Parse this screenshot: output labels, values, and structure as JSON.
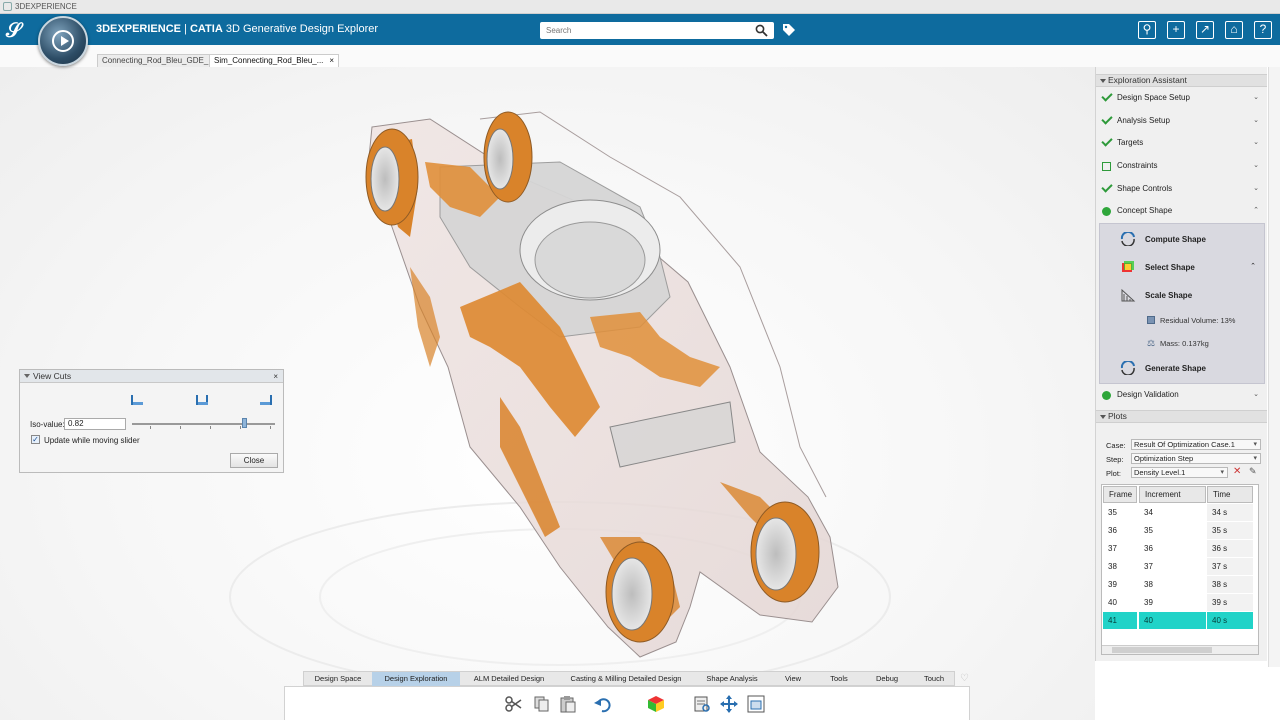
{
  "window": {
    "title": "3DEXPERIENCE"
  },
  "header": {
    "brand": "3DEXPERIENCE",
    "separator": " | ",
    "app_brand": "CATIA",
    "app_name": " 3D Generative Design Explorer",
    "search_placeholder": "Search",
    "right_icons": [
      "user-icon",
      "plus-icon",
      "share-icon",
      "home-icon",
      "help-icon"
    ]
  },
  "doc_tabs": [
    {
      "label": "Connecting_Rod_Bleu_GDE_...",
      "active": false
    },
    {
      "label": "Sim_Connecting_Rod_Bleu_...",
      "active": true,
      "close": "×"
    }
  ],
  "view_cuts": {
    "title": "View Cuts",
    "close_x": "×",
    "iso_label": "Iso-value:",
    "iso_value": "0.82",
    "iso_slider_fraction": 0.82,
    "update_label": "Update while moving slider",
    "update_checked": true,
    "close_button": "Close"
  },
  "exploration_assistant": {
    "title": "Exploration Assistant",
    "steps": [
      {
        "label": "Design Space Setup",
        "status": "done"
      },
      {
        "label": "Analysis Setup",
        "status": "done"
      },
      {
        "label": "Targets",
        "status": "done"
      },
      {
        "label": "Constraints",
        "status": "empty"
      },
      {
        "label": "Shape Controls",
        "status": "done"
      },
      {
        "label": "Concept Shape",
        "status": "active",
        "expanded": true
      }
    ],
    "concept_shape": {
      "compute": "Compute Shape",
      "select": "Select Shape",
      "scale": "Scale Shape",
      "residual_volume": "Residual Volume: 13%",
      "mass": "Mass: 0.137kg",
      "generate": "Generate Shape"
    },
    "design_validation": "Design Validation"
  },
  "plots": {
    "title": "Plots",
    "case_label": "Case:",
    "case_value": "Result Of Optimization Case.1",
    "step_label": "Step:",
    "step_value": "Optimization Step",
    "plot_label": "Plot:",
    "plot_value": "Density Level.1",
    "columns": [
      "Frame",
      "Increment",
      "Time"
    ],
    "rows": [
      [
        "35",
        "34",
        "34 s"
      ],
      [
        "36",
        "35",
        "35 s"
      ],
      [
        "37",
        "36",
        "36 s"
      ],
      [
        "38",
        "37",
        "37 s"
      ],
      [
        "39",
        "38",
        "38 s"
      ],
      [
        "40",
        "39",
        "39 s"
      ],
      [
        "41",
        "40",
        "40 s"
      ]
    ],
    "selected_row": 6
  },
  "bottom_tabs": [
    {
      "label": "Design Space",
      "active": false
    },
    {
      "label": "Design Exploration",
      "active": true
    },
    {
      "label": "ALM Detailed Design",
      "active": false
    },
    {
      "label": "Casting & Milling Detailed Design",
      "active": false
    },
    {
      "label": "Shape Analysis",
      "active": false
    },
    {
      "label": "View",
      "active": false
    },
    {
      "label": "Tools",
      "active": false
    },
    {
      "label": "Debug",
      "active": false
    },
    {
      "label": "Touch",
      "active": false
    }
  ],
  "action_icons": [
    "cut-icon",
    "copy-icon",
    "paste-icon",
    "undo-icon",
    "color-cube-icon",
    "view-cut-icon",
    "move-icon",
    "frame-icon"
  ],
  "colors": {
    "brand_blue": "#0e6b9e",
    "accent_selection": "#21d3c8",
    "status_green": "#2ea63a",
    "model_orange": "#d9832a"
  }
}
